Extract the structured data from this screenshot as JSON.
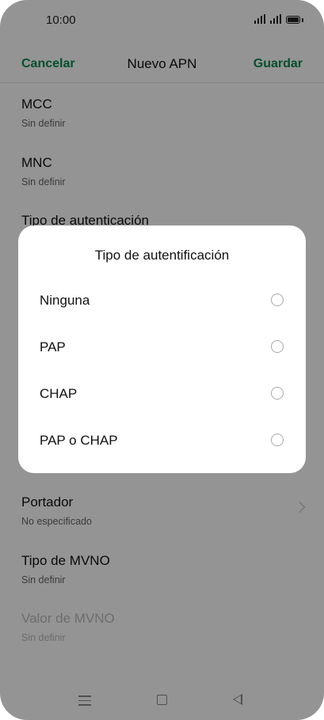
{
  "status_bar": {
    "time": "10:00"
  },
  "appbar": {
    "cancel_label": "Cancelar",
    "title": "Nuevo APN",
    "save_label": "Guardar"
  },
  "fields": [
    {
      "label": "MCC",
      "value": "Sin definir"
    },
    {
      "label": "MNC",
      "value": "Sin definir"
    },
    {
      "label": "Tipo de autenticación",
      "value": ""
    },
    {
      "label": "Portador",
      "value": "No especificado"
    },
    {
      "label": "Tipo de MVNO",
      "value": "Sin definir"
    },
    {
      "label": "Valor de MVNO",
      "value": "Sin definir",
      "disabled": true
    }
  ],
  "dialog": {
    "title": "Tipo de autentificación",
    "options": [
      "Ninguna",
      "PAP",
      "CHAP",
      "PAP o CHAP"
    ]
  },
  "colors": {
    "accent": "#0a8a4f",
    "scrim": "rgba(0,0,0,0.42)"
  }
}
